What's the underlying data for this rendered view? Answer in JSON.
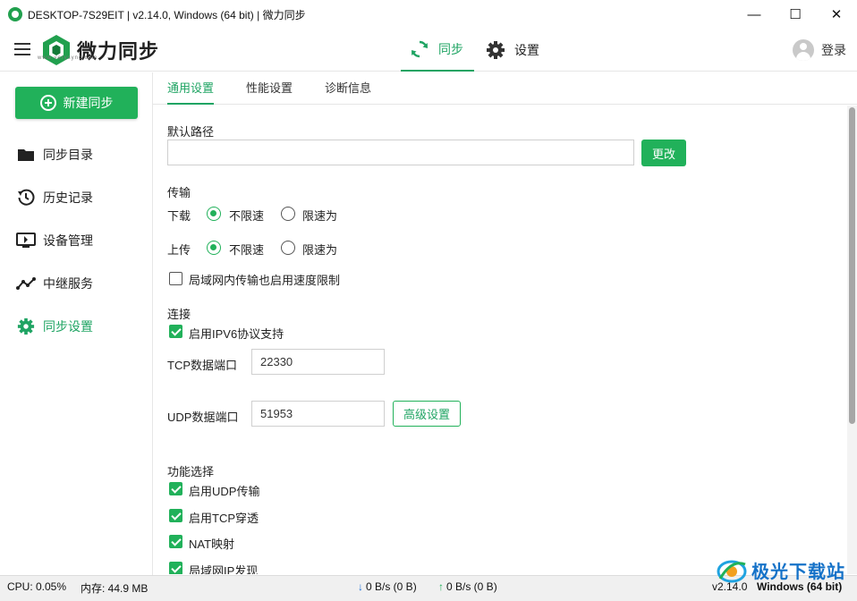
{
  "window": {
    "title": "DESKTOP-7S29EIT | v2.14.0, Windows (64 bit) | 微力同步",
    "minimize": "—",
    "maximize": "☐",
    "close": "✕"
  },
  "header": {
    "logo_text": "微力同步",
    "logo_sub": "www.verysync.com",
    "tabs": [
      {
        "label": "同步",
        "icon": "sync-icon",
        "active": true
      },
      {
        "label": "设置",
        "icon": "gear-icon",
        "active": false
      }
    ],
    "login_label": "登录"
  },
  "sidebar": {
    "new_sync_label": "新建同步",
    "items": [
      {
        "label": "同步目录",
        "icon": "folder-icon"
      },
      {
        "label": "历史记录",
        "icon": "history-icon"
      },
      {
        "label": "设备管理",
        "icon": "device-icon"
      },
      {
        "label": "中继服务",
        "icon": "relay-icon"
      },
      {
        "label": "同步设置",
        "icon": "gear-icon",
        "active": true
      }
    ]
  },
  "subtabs": [
    {
      "label": "通用设置",
      "active": true
    },
    {
      "label": "性能设置",
      "active": false
    },
    {
      "label": "诊断信息",
      "active": false
    }
  ],
  "settings": {
    "default_path_label": "默认路径",
    "default_path_value": "",
    "change_button": "更改",
    "transfer_label": "传输",
    "download_label": "下载",
    "upload_label": "上传",
    "unlimited_label": "不限速",
    "limit_label": "限速为",
    "download_unlimited": true,
    "upload_unlimited": true,
    "lan_limit_label": "局域网内传输也启用速度限制",
    "lan_limit_checked": false,
    "connection_label": "连接",
    "ipv6_label": "启用IPV6协议支持",
    "ipv6_checked": true,
    "tcp_port_label": "TCP数据端口",
    "tcp_port_value": "22330",
    "udp_port_label": "UDP数据端口",
    "udp_port_value": "51953",
    "advanced_button": "高级设置",
    "features_label": "功能选择",
    "features": [
      {
        "label": "启用UDP传输",
        "checked": true
      },
      {
        "label": "启用TCP穿透",
        "checked": true
      },
      {
        "label": "NAT映射",
        "checked": true
      },
      {
        "label": "局域网IP发现",
        "checked": true
      }
    ]
  },
  "statusbar": {
    "cpu": "CPU: 0.05%",
    "memory": "内存: 44.9 MB",
    "download_speed": "0 B/s (0 B)",
    "upload_speed": "0 B/s (0 B)",
    "version": "v2.14.0",
    "platform": "Windows (64 bit)"
  },
  "watermark": {
    "text": "极光下载站"
  },
  "colors": {
    "accent": "#21b15a",
    "accent_text": "#1fa463"
  }
}
